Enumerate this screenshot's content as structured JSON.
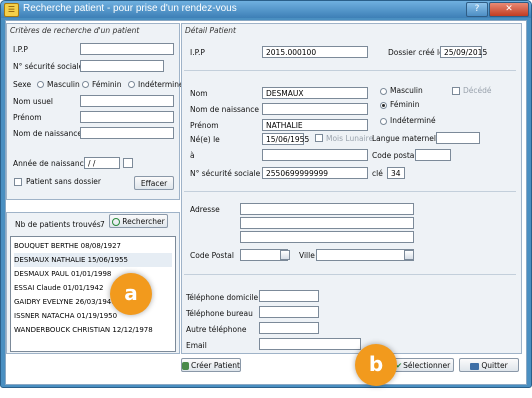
{
  "window": {
    "title": "Recherche patient - pour prise d'un rendez-vous",
    "help_label": "?",
    "close_label": "✕"
  },
  "left": {
    "criteria_title": "Critères de recherche d'un patient",
    "ipp_label": "I.P.P",
    "ssn_label": "N° sécurité sociale",
    "sex_label": "Sexe",
    "sex_options": [
      "Masculin",
      "Féminin",
      "Indéterminé"
    ],
    "usual_name_label": "Nom usuel",
    "firstname_label": "Prénom",
    "birthname_label": "Nom de naissance",
    "birthyear_label": "Année de naissance",
    "birthyear_value": "/ /",
    "no_file_label": "Patient sans dossier",
    "clear_button": "Effacer",
    "found_label": "Nb de patients trouvés",
    "found_count": "7",
    "search_button": "Rechercher",
    "patients": [
      "BOUQUET BERTHE 08/08/1927",
      "DESMAUX NATHALIE 15/06/1955",
      "DESMAUX PAUL 01/01/1998",
      "ESSAI Claude 01/01/1942",
      "GAIDRY EVELYNE 26/03/1946",
      "ISSNER NATACHA 01/19/1950",
      "WANDERBOUCK CHRISTIAN 12/12/1978"
    ],
    "create_button": "Créer Patient"
  },
  "right": {
    "detail_title": "Détail Patient",
    "ipp_label": "I.P.P",
    "ipp_value": "2015.000100",
    "created_label": "Dossier créé le",
    "created_value": "25/09/2015",
    "nom_label": "Nom",
    "nom_value": "DESMAUX",
    "birthname_label": "Nom de naissance",
    "prenom_label": "Prénom",
    "prenom_value": "NATHALIE",
    "born_label": "Né(e) le",
    "born_value": "15/06/1955",
    "lunar_label": "Mois Lunaire",
    "mother_tongue_label": "Langue maternelle",
    "a_label": "à",
    "postal_label": "Code postal",
    "ssn_label": "N° sécurité sociale",
    "ssn_value": "2550699999999",
    "key_label": "clé",
    "key_value": "34",
    "sex_options": [
      "Masculin",
      "Féminin",
      "Indéterminé"
    ],
    "deceased_label": "Décédé",
    "address_label": "Adresse",
    "postcode_label": "Code Postal",
    "city_label": "Ville",
    "home_phone_label": "Téléphone domicile",
    "office_phone_label": "Téléphone bureau",
    "other_phone_label": "Autre téléphone",
    "email_label": "Email",
    "select_button": "Sélectionner",
    "quit_button": "Quitter"
  },
  "callouts": {
    "a": "a",
    "b": "b"
  },
  "colors": {
    "title_bar": "#3d7fb6",
    "callout": "#f29a1d",
    "frame": "#4a8fc1"
  }
}
